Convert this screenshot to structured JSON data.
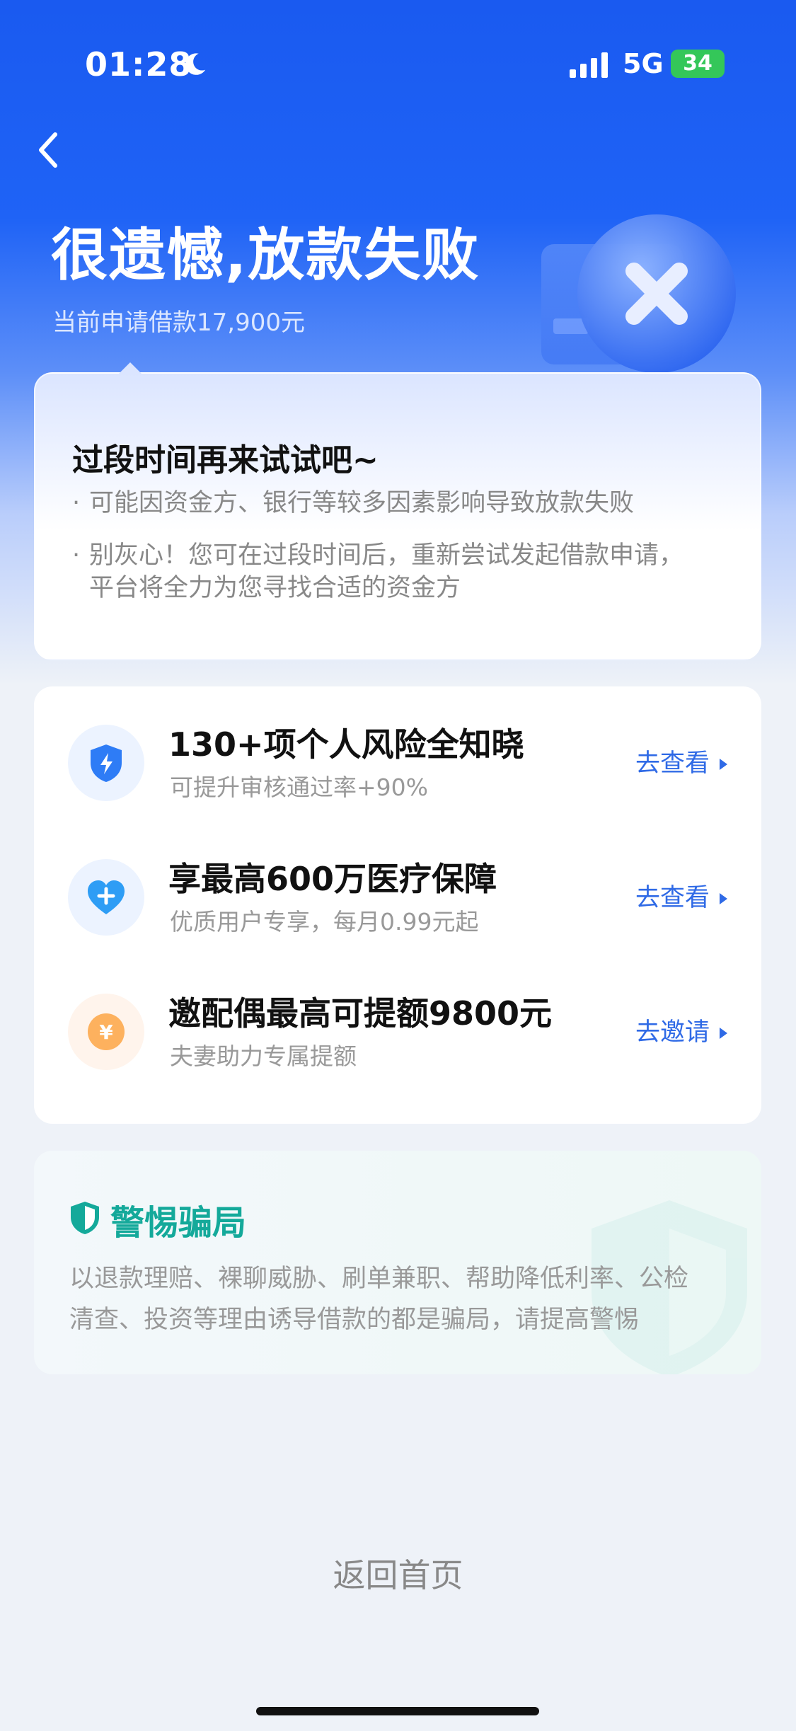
{
  "status_bar": {
    "time": "01:28",
    "network": "5G",
    "battery": "34"
  },
  "header": {
    "title": "很遗憾,放款失败",
    "subtitle": "当前申请借款17,900元"
  },
  "info_card": {
    "title": "过段时间再来试试吧~",
    "bullet": "·",
    "items": [
      [
        "可能因资金方、银行等较多因素影响导致放款失败"
      ],
      [
        "别灰心！您可在过段时间后，重新尝试发起借款申请，",
        "平台将全力为您寻找合适的资金方"
      ]
    ]
  },
  "services": [
    {
      "title": "130+项个人风险全知晓",
      "subtitle": "可提升审核通过率+90%",
      "action": "去查看",
      "icon": "shield-bolt-icon"
    },
    {
      "title": "享最高600万医疗保障",
      "subtitle": "优质用户专享，每月0.99元起",
      "action": "去查看",
      "icon": "heart-plus-icon"
    },
    {
      "title": "邀配偶最高可提额9800元",
      "subtitle": "夫妻助力专属提额",
      "action": "去邀请",
      "icon": "yuan-coin-icon"
    }
  ],
  "fraud": {
    "title": "警惕骗局",
    "lines": [
      "以退款理赔、裸聊威胁、刷单兼职、帮助降低利率、公检",
      "清查、投资等理由诱导借款的都是骗局，请提高警惕"
    ]
  },
  "footer": {
    "home_label": "返回首页"
  },
  "colors": {
    "brand_blue": "#1f63f6",
    "action_blue": "#2f6ae6",
    "fraud_green": "#14a99a"
  }
}
